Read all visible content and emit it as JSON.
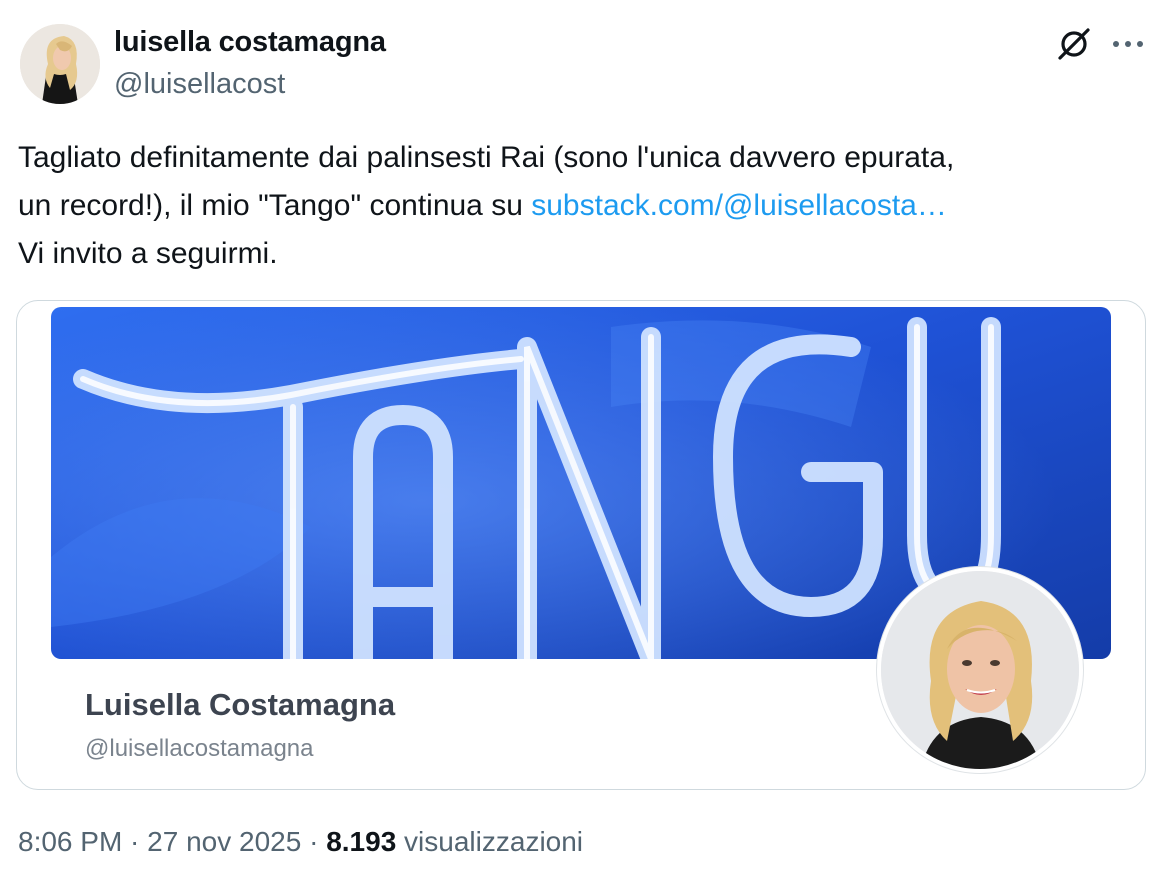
{
  "author": {
    "name": "luisella costamagna",
    "handle": "@luisellacost"
  },
  "header_icons": {
    "grok": "grok-slash-icon",
    "more": "more-dots-icon"
  },
  "tweet": {
    "line1": "Tagliato definitamente dai palinsesti Rai (sono l'unica davvero epurata,",
    "line2_prefix": "un record!), il mio \"Tango\" continua su ",
    "link_text": "substack.com/@luisellacosta…",
    "line3": "Vi invito a seguirmi."
  },
  "card": {
    "banner_text": "TANGO",
    "name": "Luisella Costamagna",
    "handle": "@luisellacostamagna"
  },
  "meta": {
    "time": "8:06 PM",
    "sep1": " · ",
    "date": "27 nov 2025",
    "sep2": " · ",
    "views_count": "8.193",
    "views_label": " visualizzazioni"
  },
  "colors": {
    "link": "#1d9bf0",
    "secondary_text": "#536471",
    "banner_blue": "#1a4fd0",
    "card_border": "#cfd9de"
  }
}
